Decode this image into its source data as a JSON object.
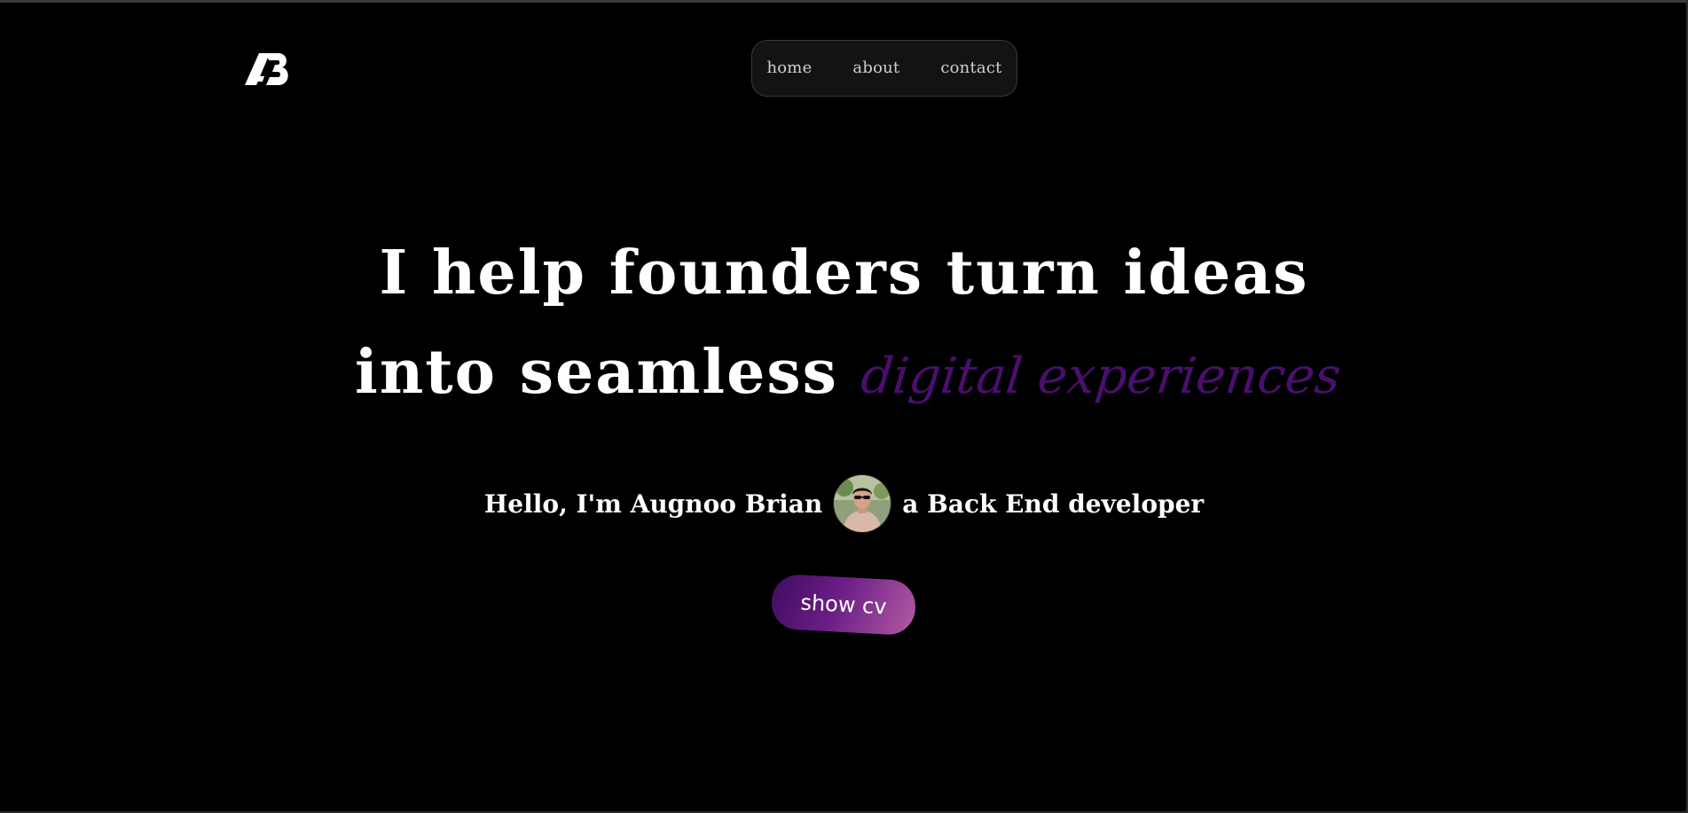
{
  "logo": {
    "alt": "AB"
  },
  "nav": {
    "items": [
      {
        "label": "home"
      },
      {
        "label": "about"
      },
      {
        "label": "contact"
      }
    ]
  },
  "hero": {
    "line1": "I help founders turn ideas",
    "line2_prefix": "into seamless",
    "line2_accent": "digital experiences"
  },
  "intro": {
    "before_avatar": "Hello, I'm Augnoo Brian",
    "after_avatar": "a Back End developer"
  },
  "cta": {
    "label": "show cv"
  },
  "colors": {
    "background": "#000000",
    "accent": "#4a0e6d",
    "button_start": "#3f0d5f",
    "button_end": "#b25aa3",
    "nav_bg": "#131313"
  }
}
